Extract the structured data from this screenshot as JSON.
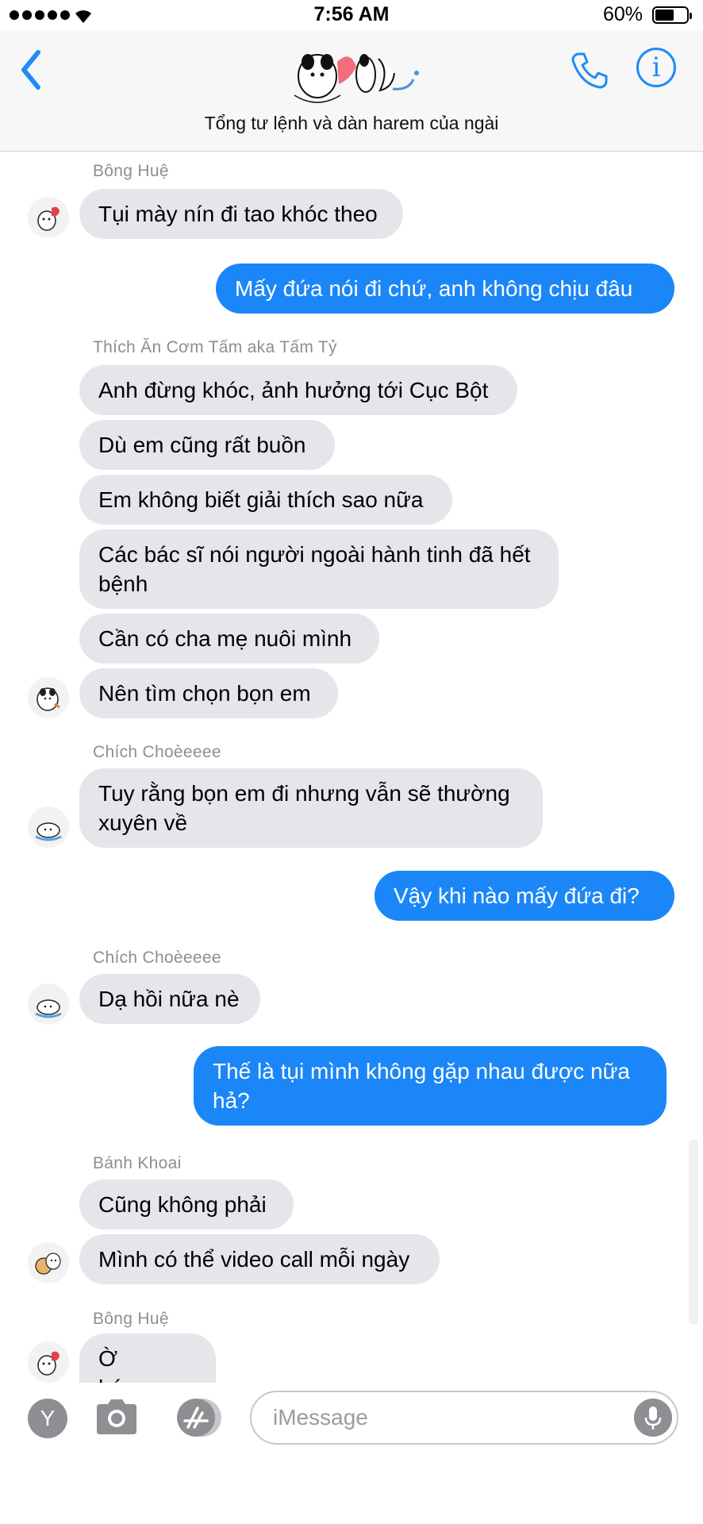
{
  "status_bar": {
    "time": "7:56 AM",
    "battery": "60%",
    "battery_level": 0.6
  },
  "nav": {
    "title": "Tổng tư lệnh và dàn harem của ngài"
  },
  "messages": [
    {
      "sender": "Bông Huệ",
      "text": "Tụi mày nín đi tao khóc theo"
    },
    {
      "text": "Mấy đứa nói đi chứ, anh không chịu đâu"
    },
    {
      "sender": "Thích Ăn Cơm Tấm aka Tấm Tỷ",
      "text": "Anh đừng khóc, ảnh hưởng tới Cục Bột"
    },
    {
      "text": "Dù em cũng rất buồn"
    },
    {
      "text": "Em không biết giải thích sao nữa"
    },
    {
      "text": "Các bác sĩ nói người ngoài hành tinh đã hết bệnh"
    },
    {
      "text": "Cần có cha mẹ nuôi mình"
    },
    {
      "text": "Nên tìm chọn bọn em"
    },
    {
      "sender": "Chích Choèeeee",
      "text": "Tuy rằng bọn em đi nhưng vẫn sẽ thường xuyên về"
    },
    {
      "text": "Vậy khi nào mấy đứa đi?"
    },
    {
      "sender": "Chích Choèeeee",
      "text": "Dạ hồi nữa nè"
    },
    {
      "text": "Thế là tụi mình không gặp nhau được nữa hả?"
    },
    {
      "sender": "Bánh Khoai",
      "text": "Cũng không phải"
    },
    {
      "text": "Mình có thể video call mỗi ngày"
    },
    {
      "sender": "Bông Huệ",
      "text": "Ờ háaaaa"
    }
  ],
  "composer": {
    "apps_label": "Y",
    "placeholder": "iMessage"
  }
}
